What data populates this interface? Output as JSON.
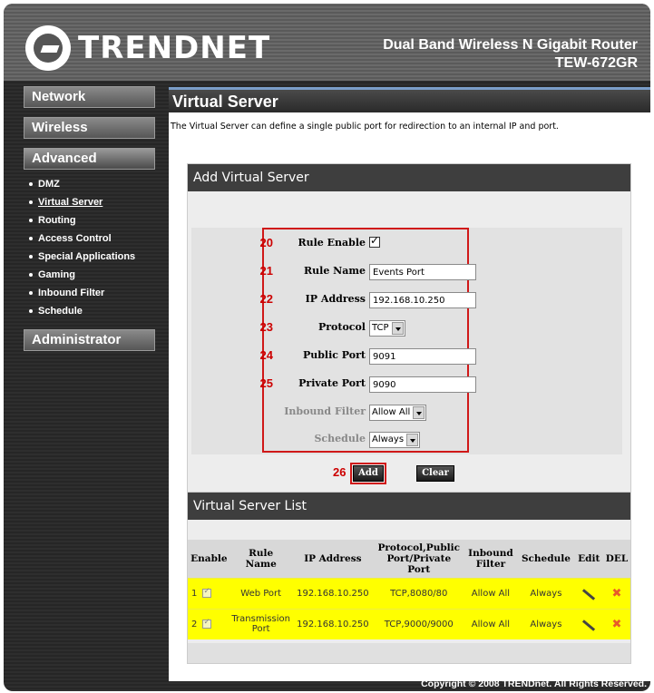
{
  "brand": {
    "logo_text": "TRENDNET",
    "product_line1": "Dual Band Wireless N Gigabit Router",
    "product_line2": "TEW-672GR"
  },
  "sidebar": {
    "network": "Network",
    "wireless": "Wireless",
    "advanced": "Advanced",
    "administrator": "Administrator",
    "advanced_items": [
      "DMZ",
      "Virtual Server",
      "Routing",
      "Access Control",
      "Special Applications",
      "Gaming",
      "Inbound Filter",
      "Schedule"
    ]
  },
  "page": {
    "title": "Virtual Server",
    "description": "The Virtual Server can define a single public port for redirection to an internal IP and port."
  },
  "add_form": {
    "heading": "Add Virtual Server",
    "fields": [
      {
        "num": "20",
        "label": "Rule Enable",
        "type": "checkbox",
        "checked": true
      },
      {
        "num": "21",
        "label": "Rule Name",
        "type": "text",
        "value": "Events Port"
      },
      {
        "num": "22",
        "label": "IP Address",
        "type": "text",
        "value": "192.168.10.250"
      },
      {
        "num": "23",
        "label": "Protocol",
        "type": "select",
        "value": "TCP"
      },
      {
        "num": "24",
        "label": "Public Port",
        "type": "text",
        "value": "9091"
      },
      {
        "num": "25",
        "label": "Private Port",
        "type": "text",
        "value": "9090"
      },
      {
        "num": "",
        "label": "Inbound Filter",
        "type": "select",
        "value": "Allow All"
      },
      {
        "num": "",
        "label": "Schedule",
        "type": "select",
        "value": "Always"
      }
    ],
    "add_num": "26",
    "add_label": "Add",
    "clear_label": "Clear"
  },
  "list": {
    "heading": "Virtual Server List",
    "columns": [
      "Enable",
      "Rule Name",
      "IP Address",
      "Protocol,Public Port/Private Port",
      "Inbound Filter",
      "Schedule",
      "Edit",
      "DEL"
    ],
    "rows": [
      {
        "index": "1",
        "name": "Web Port",
        "ip": "192.168.10.250",
        "proto": "TCP,8080/80",
        "filter": "Allow All",
        "schedule": "Always"
      },
      {
        "index": "2",
        "name": "Transmission Port",
        "ip": "192.168.10.250",
        "proto": "TCP,9000/9000",
        "filter": "Allow All",
        "schedule": "Always"
      }
    ]
  },
  "footer": {
    "copyright": "Copyright © 2008 TRENDnet. All Rights Reserved."
  },
  "icons": {
    "edit": "pencil-icon",
    "delete": "delete-x-icon",
    "logo": "trendnet-logo-icon"
  },
  "colors": {
    "row_highlight": "#ffff00",
    "annotation_red": "#d01818",
    "header_bar": "#3e3e3e"
  }
}
